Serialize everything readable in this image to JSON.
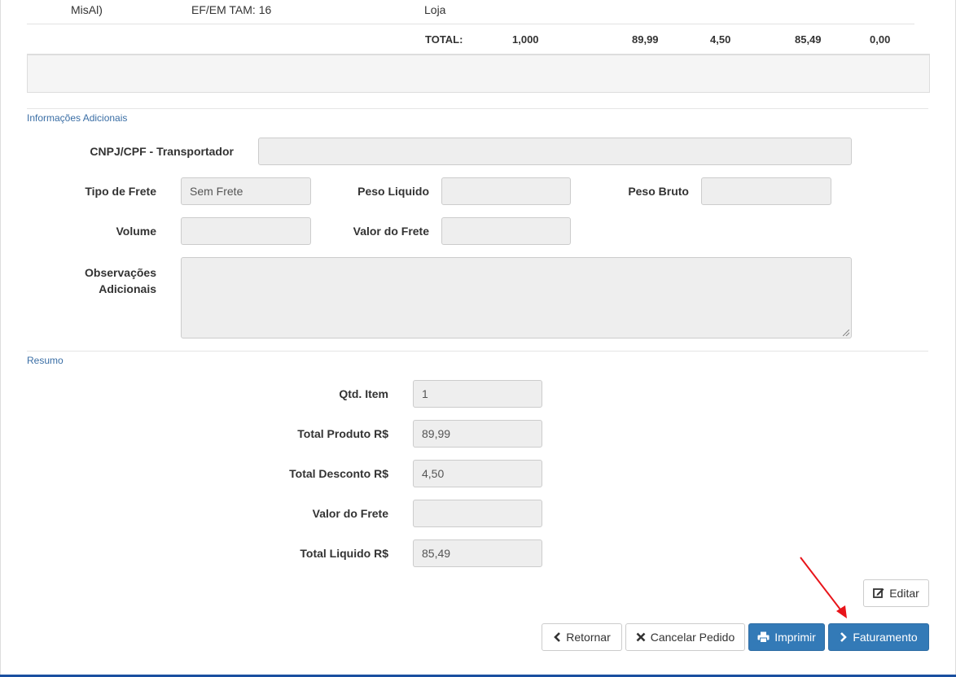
{
  "table": {
    "row_partial": {
      "col1": "MisAl)",
      "col2": "EF/EM TAM: 16",
      "col3": "Loja"
    },
    "total_row": {
      "label": "TOTAL:",
      "qty": "1,000",
      "value": "89,99",
      "discount": "4,50",
      "net": "85,49",
      "other": "0,00"
    }
  },
  "info_section": {
    "title": "Informações Adicionais",
    "cnpj_label": "CNPJ/CPF - Transportador",
    "cnpj_value": "",
    "tipo_frete_label": "Tipo de Frete",
    "tipo_frete_value": "Sem Frete",
    "peso_liquido_label": "Peso Liquido",
    "peso_liquido_value": "",
    "peso_bruto_label": "Peso Bruto",
    "peso_bruto_value": "",
    "volume_label": "Volume",
    "volume_value": "",
    "valor_frete_label": "Valor do Frete",
    "valor_frete_value": "",
    "obs_label_line1": "Observações",
    "obs_label_line2": "Adicionais",
    "obs_value": ""
  },
  "summary_section": {
    "title": "Resumo",
    "qtd_item_label": "Qtd. Item",
    "qtd_item_value": "1",
    "total_produto_label": "Total Produto R$",
    "total_produto_value": "89,99",
    "total_desconto_label": "Total Desconto R$",
    "total_desconto_value": "4,50",
    "valor_frete_label": "Valor do Frete",
    "valor_frete_value": "",
    "total_liquido_label": "Total Liquido R$",
    "total_liquido_value": "85,49"
  },
  "actions": {
    "editar": "Editar",
    "retornar": "Retornar",
    "cancelar": "Cancelar Pedido",
    "imprimir": "Imprimir",
    "faturamento": "Faturamento"
  },
  "colors": {
    "primary": "#337ab7",
    "annotation_arrow": "#e8141a",
    "section_title": "#3a6ea5"
  }
}
